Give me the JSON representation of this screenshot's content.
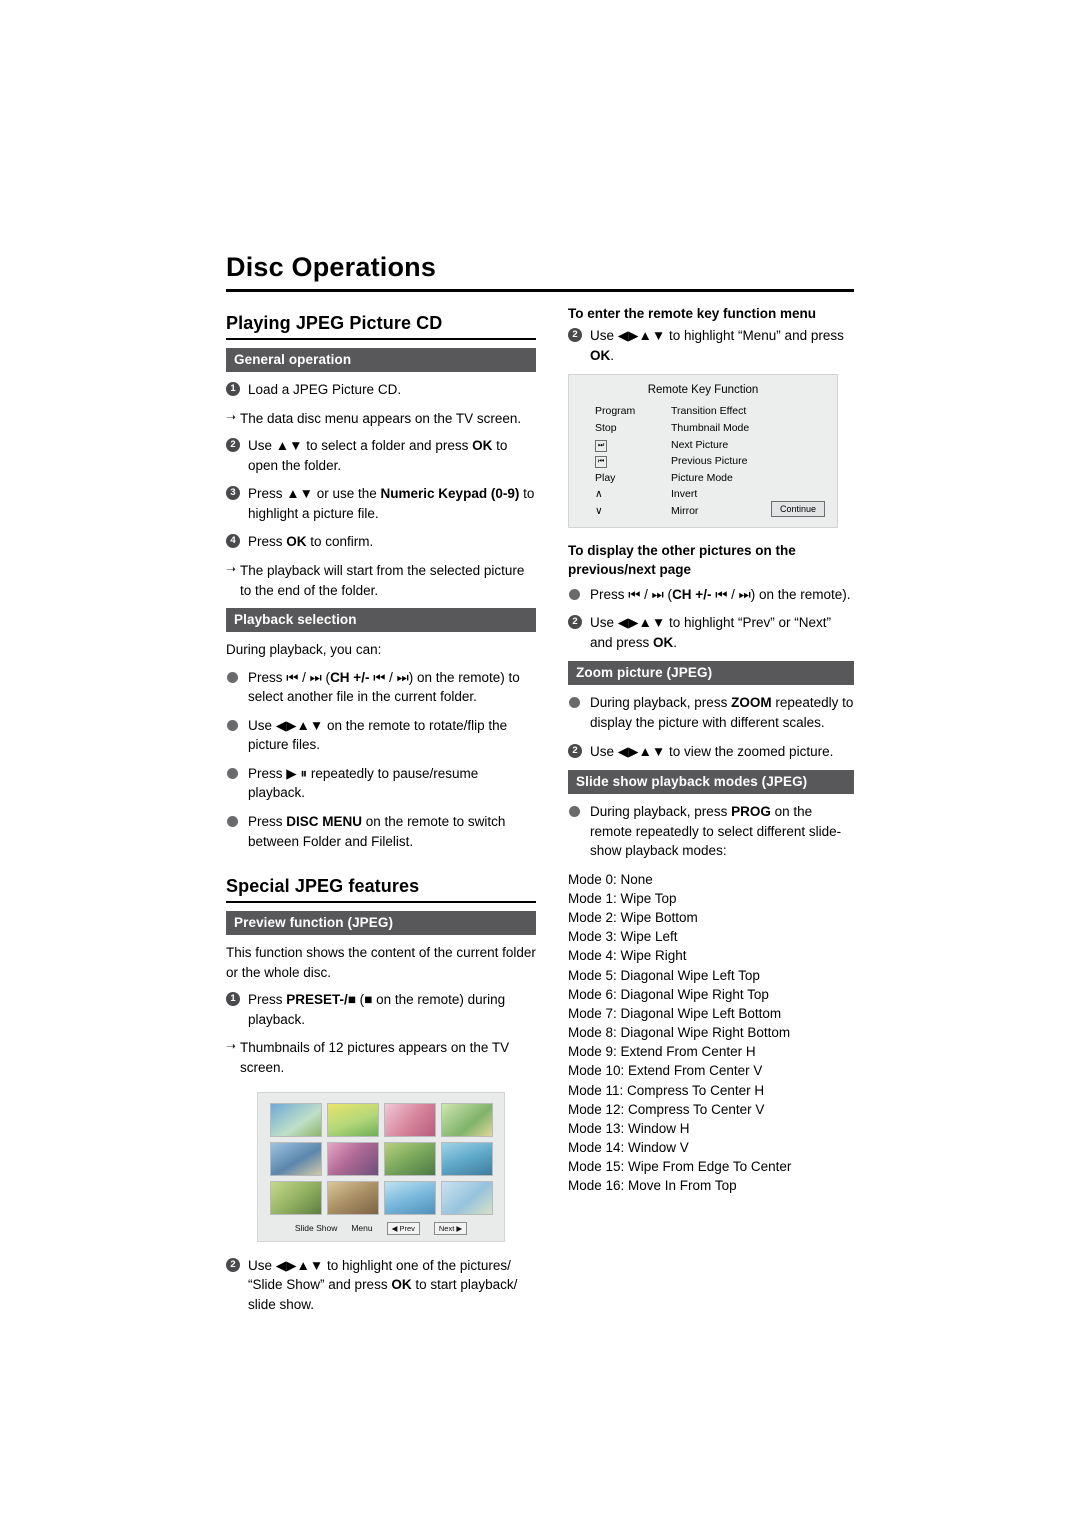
{
  "page": {
    "title": "Disc Operations"
  },
  "left": {
    "section1_title": "Playing JPEG Picture CD",
    "bar_general": "General operation",
    "steps": [
      {
        "n": "1",
        "text": "Load a JPEG Picture CD."
      },
      {
        "n": "2",
        "text": "Use ▲▼  to select a folder and press OK to open the folder."
      },
      {
        "n": "3",
        "text": "Press ▲▼  or use the Numeric Keypad (0-9) to highlight a picture file."
      },
      {
        "n": "4",
        "text": "Press OK to confirm."
      }
    ],
    "arrow1": "The data disc menu appears on the TV screen.",
    "arrow2": "The playback will start from the selected picture to the end of the folder.",
    "bar_playback": "Playback selection",
    "playback_intro": "During playback, you can:",
    "playback_items": [
      "Press ⏮ / ⏭ (CH +/- ⏮ / ⏭) on the remote) to select another file in the current folder.",
      "Use ◀▶▲▼  on the remote to rotate/flip the picture files.",
      "Press ▶ ⏸ repeatedly to pause/resume playback.",
      "Press DISC MENU on the remote to switch between Folder and Filelist."
    ],
    "section2_title": "Special JPEG features",
    "bar_preview": "Preview function (JPEG)",
    "preview_text": "This function shows the content of the current folder or the whole disc.",
    "preview_step1": "Press PRESET-/■ (■ on the remote) during playback.",
    "preview_arrow": "Thumbnails of 12 pictures appears on the TV screen.",
    "preview_step2": "Use ◀▶▲▼  to highlight one of the pictures/ “Slide Show” and press OK to start playback/ slide show.",
    "tv_buttons": {
      "slide_show": "Slide Show",
      "menu": "Menu",
      "prev": "◀ Prev",
      "next": "Next ▶"
    }
  },
  "right": {
    "head_remote_menu": "To enter the remote key function menu",
    "remote_menu_step": "Use ◀▶▲▼  to highlight “Menu” and press OK.",
    "remote_menu_step_num": "2",
    "remote_box": {
      "title": "Remote Key Function",
      "rows": [
        {
          "key": "Program",
          "value": "Transition Effect"
        },
        {
          "key": "Stop",
          "value": "Thumbnail Mode"
        },
        {
          "key": "⏭",
          "value": "Next Picture"
        },
        {
          "key": "⏮",
          "value": "Previous Picture"
        },
        {
          "key": "Play",
          "value": "Picture Mode"
        },
        {
          "key": "∧",
          "value": "Invert"
        },
        {
          "key": "∨",
          "value": "Mirror"
        }
      ],
      "continue": "Continue"
    },
    "head_other_pictures": "To display the other pictures on the previous/next page",
    "other_item1": "Press ⏮ / ⏭ (CH +/- ⏮ / ⏭) on the remote).",
    "other_item2": "Use ◀▶▲▼  to highlight “Prev” or “Next” and press OK.",
    "bar_zoom": "Zoom picture (JPEG)",
    "zoom_item1": "During playback, press ZOOM repeatedly to display the picture with different scales.",
    "zoom_item2": "Use ◀▶▲▼  to view the zoomed picture.",
    "bar_slideshow": "Slide show playback modes (JPEG)",
    "slideshow_item": "During playback, press PROG on the remote repeatedly to select different slide-show playback modes:",
    "modes": [
      "Mode 0: None",
      "Mode 1: Wipe Top",
      "Mode 2: Wipe Bottom",
      "Mode 3: Wipe Left",
      "Mode 4: Wipe Right",
      "Mode 5: Diagonal Wipe Left Top",
      "Mode 6: Diagonal Wipe Right Top",
      "Mode 7: Diagonal Wipe Left Bottom",
      "Mode 8: Diagonal Wipe Right Bottom",
      "Mode 9: Extend From Center H",
      "Mode 10: Extend From Center V",
      "Mode 11: Compress To Center H",
      "Mode 12: Compress To Center V",
      "Mode 13: Window H",
      "Mode 14: Window V",
      "Mode 15: Wipe From Edge To Center",
      "Mode 16: Move In From Top"
    ]
  }
}
